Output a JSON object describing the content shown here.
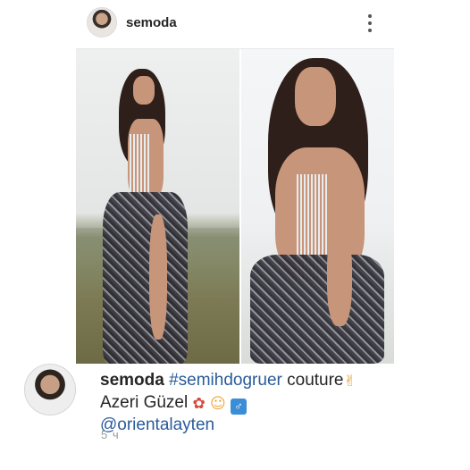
{
  "post": {
    "username": "semoda",
    "more_icon": "more-vertical-icon"
  },
  "caption": {
    "username": "semoda",
    "hashtag": "#semihdogruer",
    "text_1": " couture",
    "emoji_1": "✌",
    "line_2": "Azeri Güzel",
    "emoji_2": "✿",
    "emoji_3": "☺",
    "emoji_4": "♂",
    "mention": "@orientalayten"
  },
  "timestamp": "5 ч",
  "colors": {
    "link": "#2a5b9a",
    "text": "#262626",
    "muted": "#9a9a9a"
  }
}
